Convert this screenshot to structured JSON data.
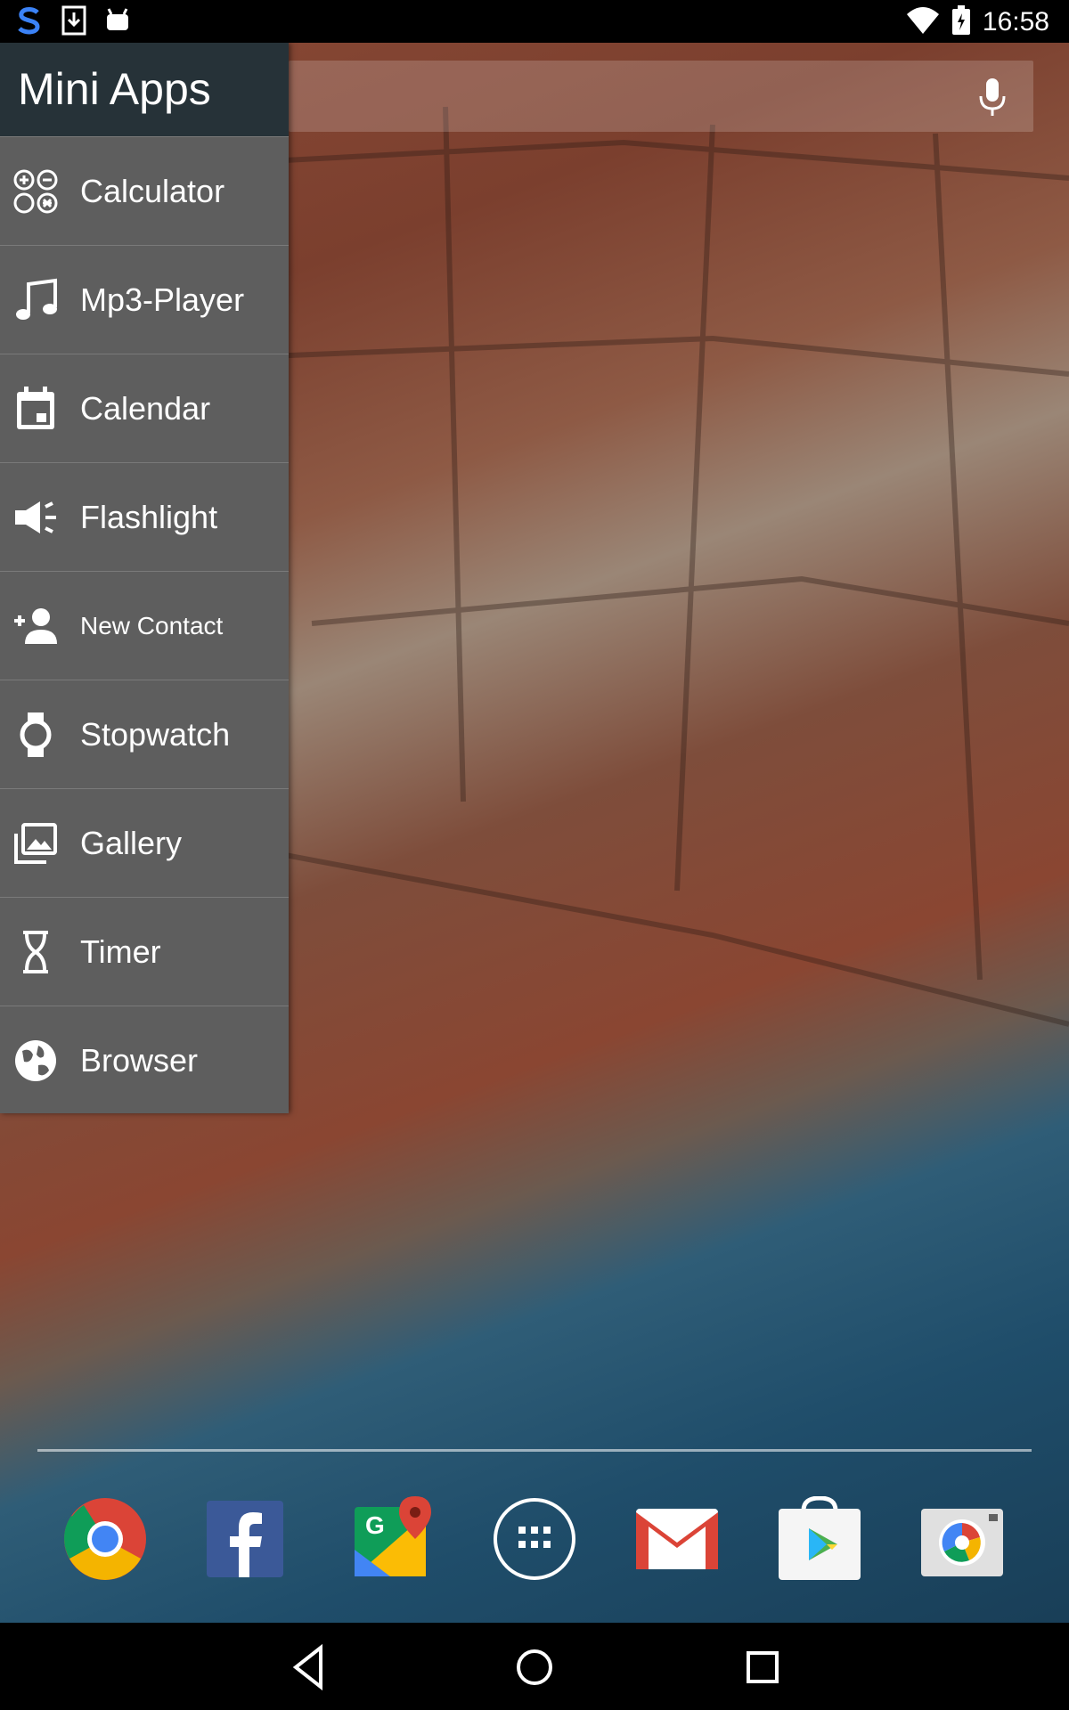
{
  "status": {
    "time": "16:58",
    "left_icons": [
      "s-app-icon",
      "download-icon",
      "android-icon"
    ],
    "right_icons": [
      "wifi-icon",
      "battery-icon"
    ]
  },
  "search": {
    "placeholder": "",
    "mic_icon": "mic-icon"
  },
  "drawer": {
    "title": "Mini Apps",
    "items": [
      {
        "label": "Calculator",
        "icon": "calculator-icon"
      },
      {
        "label": "Mp3-Player",
        "icon": "music-note-icon"
      },
      {
        "label": "Calendar",
        "icon": "calendar-icon"
      },
      {
        "label": "Flashlight",
        "icon": "flashlight-icon"
      },
      {
        "label": "New Contact",
        "icon": "add-person-icon"
      },
      {
        "label": "Stopwatch",
        "icon": "watch-icon"
      },
      {
        "label": "Gallery",
        "icon": "gallery-icon"
      },
      {
        "label": "Timer",
        "icon": "hourglass-icon"
      },
      {
        "label": "Browser",
        "icon": "globe-icon"
      }
    ]
  },
  "dock": {
    "apps": [
      "Chrome",
      "Facebook",
      "Maps",
      "All apps",
      "Gmail",
      "Play Store",
      "Camera"
    ]
  },
  "nav": {
    "buttons": [
      "back",
      "home",
      "recents"
    ]
  },
  "colors": {
    "drawer_bg": "#5e5e5e",
    "drawer_header_bg": "#263238",
    "status_bg": "#000000"
  }
}
